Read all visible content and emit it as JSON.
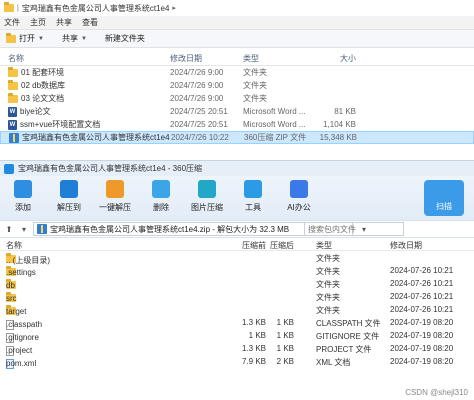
{
  "explorer": {
    "path": [
      "宝鸡瑞鑫有色金属公司人事管理系统ct1e4"
    ],
    "menu": [
      "文件",
      "主页",
      "共享",
      "查看"
    ],
    "toolbar": {
      "open": "打开",
      "share": "共享",
      "new_folder": "新建文件夹"
    },
    "columns": {
      "name": "名称",
      "date": "修改日期",
      "type": "类型",
      "size": "大小"
    },
    "rows": [
      {
        "name": "01 配套环境",
        "date": "2024/7/26 9:00",
        "type": "文件夹",
        "size": "",
        "icon": "folder-icon"
      },
      {
        "name": "02 db数据库",
        "date": "2024/7/26 9:00",
        "type": "文件夹",
        "size": "",
        "icon": "folder-icon"
      },
      {
        "name": "03 论文文档",
        "date": "2024/7/26 9:00",
        "type": "文件夹",
        "size": "",
        "icon": "folder-icon"
      },
      {
        "name": "biye论文",
        "date": "2024/7/25 20:51",
        "type": "Microsoft Word ...",
        "size": "81 KB",
        "icon": "word-icon"
      },
      {
        "name": "ssm+vue环境配置文档",
        "date": "2024/7/25 20:51",
        "type": "Microsoft Word ...",
        "size": "1,104 KB",
        "icon": "word-icon"
      },
      {
        "name": "宝鸡瑞鑫有色金属公司人事管理系统ct1e4",
        "date": "2024/7/26 10:22",
        "type": "360压缩 ZIP 文件",
        "size": "15,348 KB",
        "icon": "zip-icon"
      }
    ]
  },
  "zip": {
    "title": "宝鸡瑞鑫有色金属公司人事管理系统ct1e4 - 360压缩",
    "tools": [
      {
        "label": "添加",
        "color": "#2e8fe0"
      },
      {
        "label": "解压到",
        "color": "#1f7fd6"
      },
      {
        "label": "一键解压",
        "color": "#ee9a2a"
      },
      {
        "label": "删除",
        "color": "#3aa6e8"
      },
      {
        "label": "图片压缩",
        "color": "#22a7c9"
      },
      {
        "label": "工具",
        "color": "#2b9be6"
      },
      {
        "label": "AI办公",
        "color": "#3b78e8"
      }
    ],
    "scan_label": "扫描",
    "address": "宝鸡瑞鑫有色金属公司人事管理系统ct1e4.zip - 解包大小为 32.3 MB",
    "search_placeholder": "搜索包内文件",
    "columns": {
      "name": "名称",
      "size": "压缩前",
      "packed": "压缩后",
      "type": "类型",
      "date": "修改日期"
    },
    "rows": [
      {
        "name": ".. (上级目录)",
        "size": "",
        "packed": "",
        "type": "文件夹",
        "date": "",
        "icon": "folder-icon"
      },
      {
        "name": ".settings",
        "size": "",
        "packed": "",
        "type": "文件夹",
        "date": "2024-07-26 10:21",
        "icon": "folder-icon"
      },
      {
        "name": "db",
        "size": "",
        "packed": "",
        "type": "文件夹",
        "date": "2024-07-26 10:21",
        "icon": "folder-icon"
      },
      {
        "name": "src",
        "size": "",
        "packed": "",
        "type": "文件夹",
        "date": "2024-07-26 10:21",
        "icon": "folder-icon"
      },
      {
        "name": "target",
        "size": "",
        "packed": "",
        "type": "文件夹",
        "date": "2024-07-26 10:21",
        "icon": "folder-icon"
      },
      {
        "name": ".classpath",
        "size": "1.3 KB",
        "packed": "1 KB",
        "type": "CLASSPATH 文件",
        "date": "2024-07-19 08:20",
        "icon": "file-icon"
      },
      {
        "name": ".gitignore",
        "size": "1 KB",
        "packed": "1 KB",
        "type": "GITIGNORE 文件",
        "date": "2024-07-19 08:20",
        "icon": "file-icon"
      },
      {
        "name": ".project",
        "size": "1.3 KB",
        "packed": "1 KB",
        "type": "PROJECT 文件",
        "date": "2024-07-19 08:20",
        "icon": "file-icon"
      },
      {
        "name": "pom.xml",
        "size": "7.9 KB",
        "packed": "2 KB",
        "type": "XML 文档",
        "date": "2024-07-19 08:20",
        "icon": "xml-icon"
      }
    ]
  },
  "watermark": "CSDN @shejl310"
}
